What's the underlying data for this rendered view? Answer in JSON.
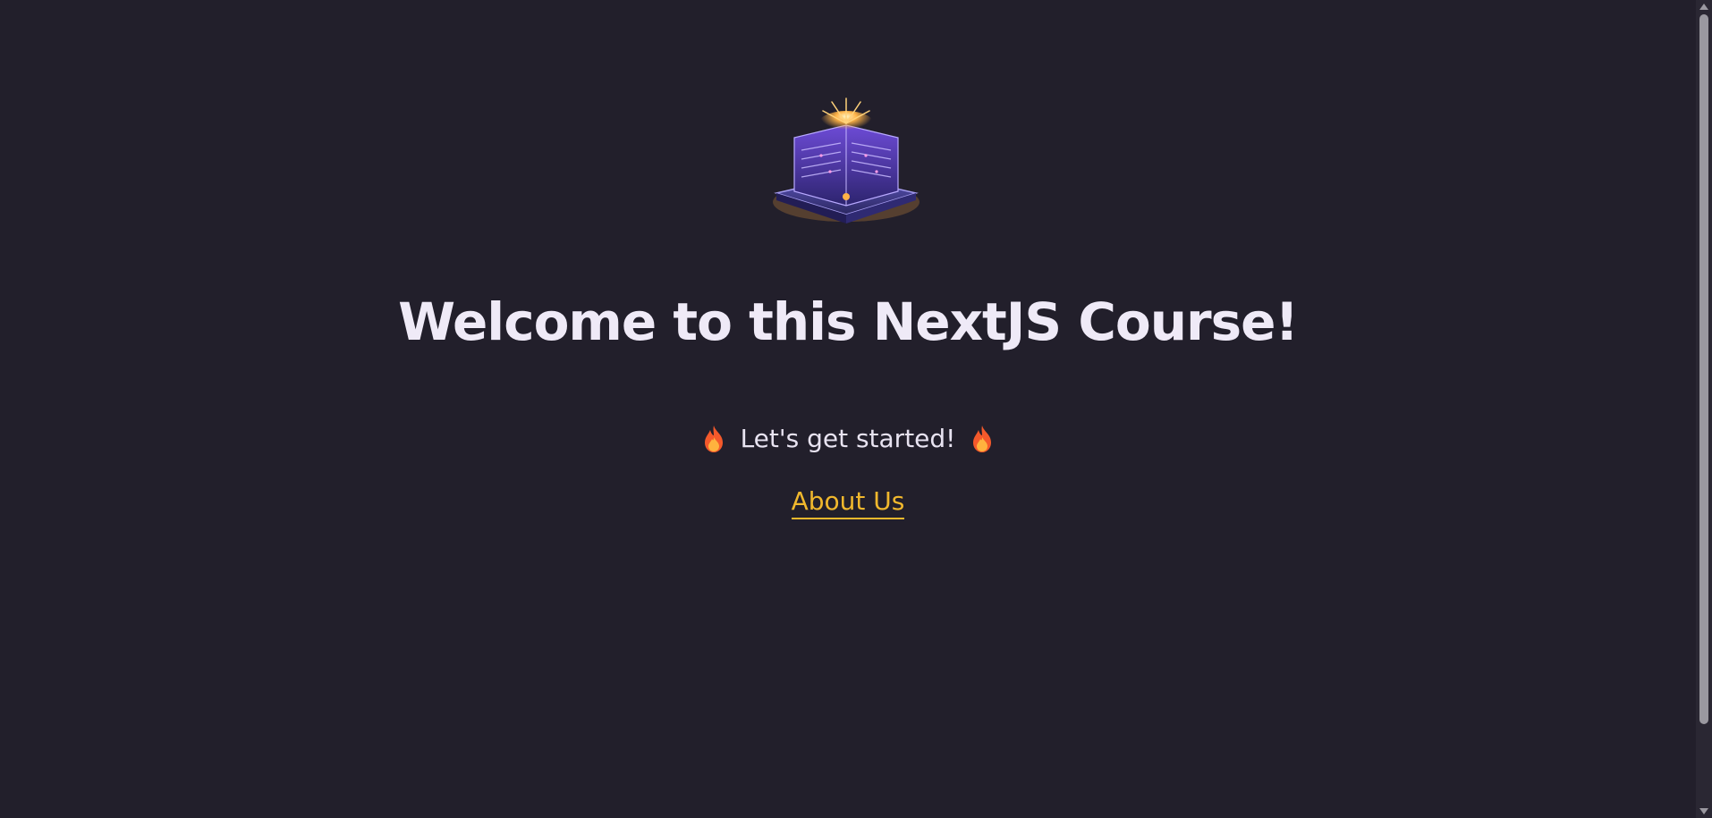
{
  "hero": {
    "logo_icon": "server-rack-sparkle-icon",
    "title": "Welcome to this NextJS Course!",
    "tagline": "Let's get started!",
    "tagline_icon": "fire-icon"
  },
  "nav": {
    "about_link": "About Us"
  },
  "colors": {
    "background": "#221f2b",
    "text": "#efeaf7",
    "link": "#f1b82d"
  }
}
